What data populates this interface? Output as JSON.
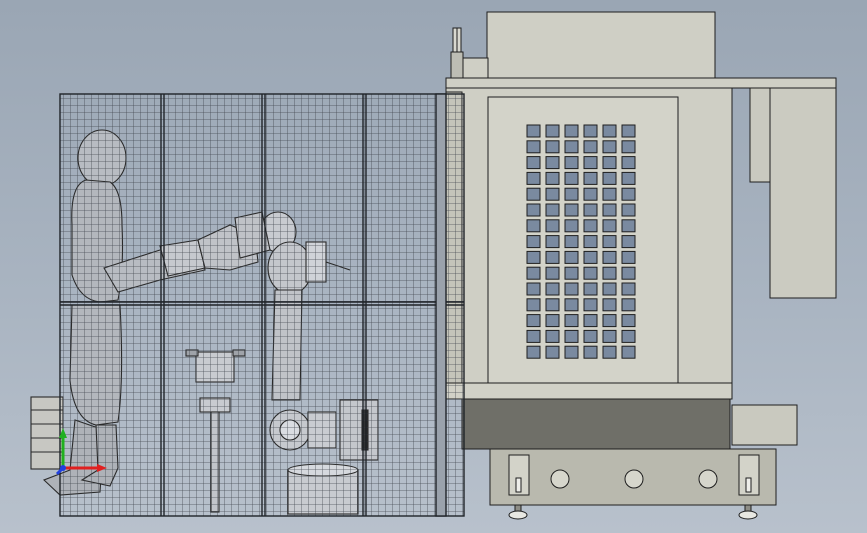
{
  "scene": {
    "view": "side elevation",
    "colors": {
      "background_top": "#9aa6b4",
      "background_bottom": "#b8c1cc",
      "machine_body": "#cfcfc5",
      "machine_shadow": "#6f6f68",
      "machine_base": "#b9b9ae",
      "outline": "#1e1e1e",
      "fence_mesh": "#3a3f47",
      "window_cell": "#7a8aa0",
      "axis_x": "#e02020",
      "axis_y": "#20b020",
      "axis_z": "#2040e0"
    },
    "machine": {
      "window_rows": 15,
      "window_cols": 6,
      "base_wheels": 3,
      "feet": 2
    },
    "fence": {
      "panels": 4
    },
    "icons": [
      "triad-axes-icon",
      "signal-tower-icon"
    ]
  }
}
